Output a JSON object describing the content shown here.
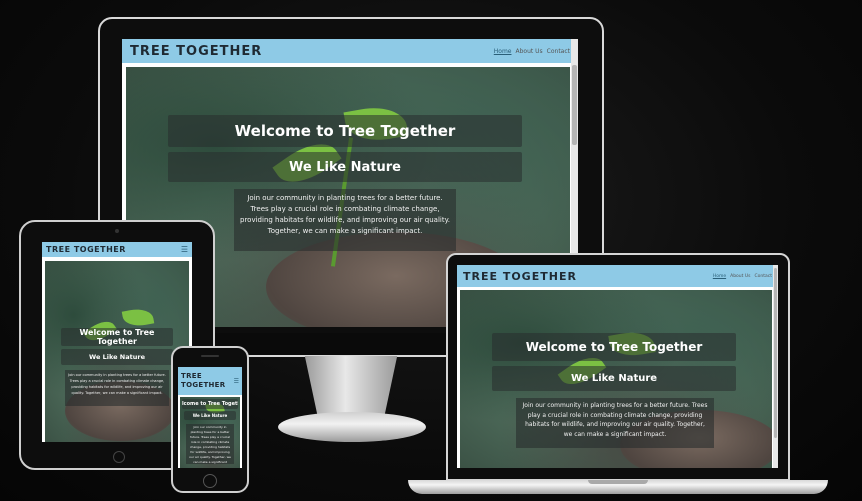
{
  "site": {
    "brand": "TREE TOGETHER",
    "brand_mobile_line1": "TREE",
    "brand_mobile_line2": "TOGETHER",
    "nav": {
      "home": "Home",
      "about": "About Us",
      "contact": "Contact"
    },
    "hero_title": "Welcome to Tree Together",
    "hero_subtitle": "We Like Nature",
    "hero_text": "Join our community in planting trees for a better future. Trees play a crucial role in combating climate change, providing habitats for wildlife, and improving our air quality. Together, we can make a significant impact.",
    "menu_icon": "hamburger-menu-icon"
  },
  "colors": {
    "nav_bg": "#8ecae6",
    "brand_text": "#1f2a33",
    "leaf": "#7bc043",
    "background": "#0b0b0b"
  }
}
